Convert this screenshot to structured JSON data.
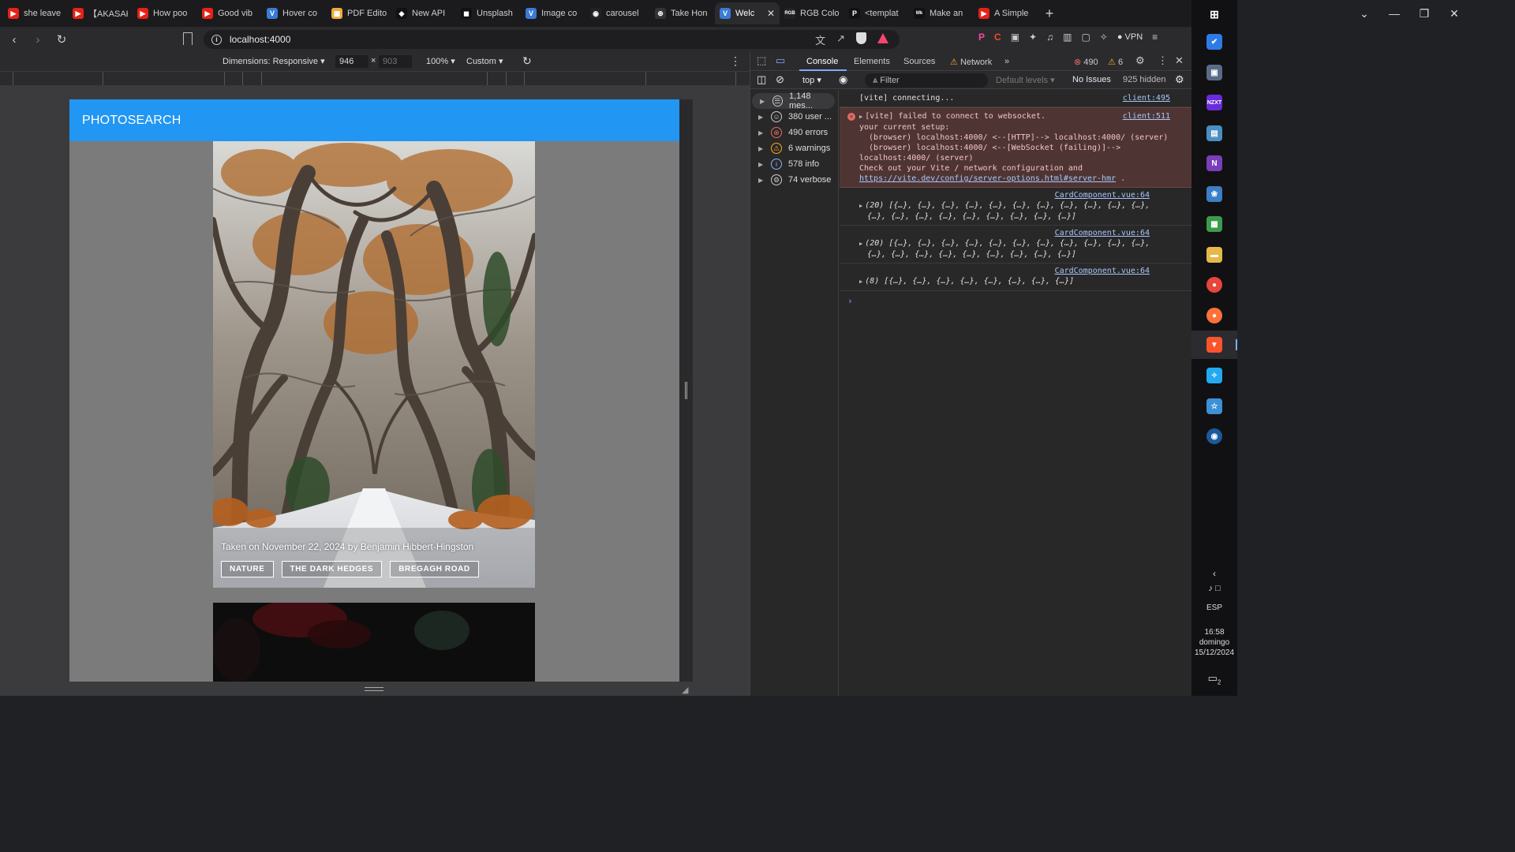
{
  "browser": {
    "tabs": [
      {
        "label": "she leave",
        "color": "#e62117",
        "glyph": "▶"
      },
      {
        "label": "【AKASAKI",
        "color": "#e62117",
        "glyph": "▶"
      },
      {
        "label": "How poo",
        "color": "#e62117",
        "glyph": "▶"
      },
      {
        "label": "Good vib",
        "color": "#e62117",
        "glyph": "▶"
      },
      {
        "label": "Hover co",
        "color": "#3a7bd5",
        "glyph": "V"
      },
      {
        "label": "PDF Edito",
        "color": "#f2a93b",
        "glyph": "▦"
      },
      {
        "label": "New API",
        "color": "#111111",
        "glyph": "◆"
      },
      {
        "label": "Unsplash",
        "color": "#111111",
        "glyph": "◼"
      },
      {
        "label": "Image co",
        "color": "#3a7bd5",
        "glyph": "V"
      },
      {
        "label": "carousel",
        "color": "#222222",
        "glyph": "◉"
      },
      {
        "label": "Take Hon",
        "color": "#333333",
        "glyph": "⊕"
      },
      {
        "label": "Welc",
        "color": "#3a7bd5",
        "glyph": "V",
        "active": true
      },
      {
        "label": "RGB Colo",
        "color": "#222222",
        "glyph": "RGB"
      },
      {
        "label": "<templat",
        "color": "#111111",
        "glyph": "P"
      },
      {
        "label": "Make an",
        "color": "#111111",
        "glyph": "Mk"
      },
      {
        "label": "A Simple",
        "color": "#e62117",
        "glyph": "▶"
      }
    ],
    "new_tab": "+",
    "window_controls": [
      "⌄",
      "—",
      "❐",
      "✕"
    ],
    "url": "localhost:4000",
    "vpn_label": "VPN"
  },
  "device_toolbar": {
    "dimensions_label": "Dimensions: Responsive",
    "width_value": "946",
    "height_placeholder": "903",
    "times": "×",
    "zoom": "100%",
    "throttle": "Custom"
  },
  "page": {
    "app_title": "PHOTOSEARCH",
    "card": {
      "caption": "Taken on November 22, 2024 by Benjamin Hibbert-Hingston",
      "tags": [
        "NATURE",
        "THE DARK HEDGES",
        "BREGAGH ROAD"
      ]
    }
  },
  "devtools": {
    "tabs": [
      "Console",
      "Elements",
      "Sources",
      "Network"
    ],
    "active_tab": "Console",
    "error_count": "490",
    "warning_count": "6",
    "context": "top",
    "filter_placeholder": "Filter",
    "levels": "Default levels",
    "issues": "No Issues",
    "hidden": "925 hidden",
    "sidebar": [
      {
        "label": "1,148 mes...",
        "icon": "list-icon",
        "color": "#cccccc"
      },
      {
        "label": "380 user ...",
        "icon": "user-icon",
        "color": "#cccccc"
      },
      {
        "label": "490 errors",
        "icon": "error-icon",
        "color": "#e46962"
      },
      {
        "label": "6 warnings",
        "icon": "warning-icon",
        "color": "#f9a825"
      },
      {
        "label": "578 info",
        "icon": "info-icon",
        "color": "#8ab4f8"
      },
      {
        "label": "74 verbose",
        "icon": "bug-icon",
        "color": "#cccccc"
      }
    ],
    "logs": {
      "connecting": "[vite] connecting...",
      "connecting_src": "client:495",
      "error_line1": "[vite] failed to connect to websocket.",
      "error_line2": "your current setup:",
      "error_line3": "(browser) localhost:4000/ <--[HTTP]--> localhost:4000/ (server)",
      "error_line4": "(browser) localhost:4000/ <--[WebSocket (failing)]-->",
      "error_line5": "localhost:4000/ (server)",
      "error_line6": "Check out your Vite / network configuration and",
      "error_link": "https://vite.dev/config/server-options.html#server-hmr",
      "error_tail": " .",
      "error_src": "client:511",
      "card_src": "CardComponent.vue:64",
      "array1_a": "(20) [{…}, {…}, {…}, {…}, {…}, {…}, {…}, {…}, {…}, {…}, {…},",
      "array1_b": "{…}, {…}, {…}, {…}, {…}, {…}, {…}, {…}, {…}]",
      "array2_a": "(20) [{…}, {…}, {…}, {…}, {…}, {…}, {…}, {…}, {…}, {…}, {…},",
      "array2_b": "{…}, {…}, {…}, {…}, {…}, {…}, {…}, {…}, {…}]",
      "array3": "(8) [{…}, {…}, {…}, {…}, {…}, {…}, {…}, {…}]",
      "prompt": "›"
    }
  },
  "taskbar": {
    "lang": "ESP",
    "time": "16:58",
    "day": "domingo",
    "date": "15/12/2024",
    "notifications": "2"
  }
}
